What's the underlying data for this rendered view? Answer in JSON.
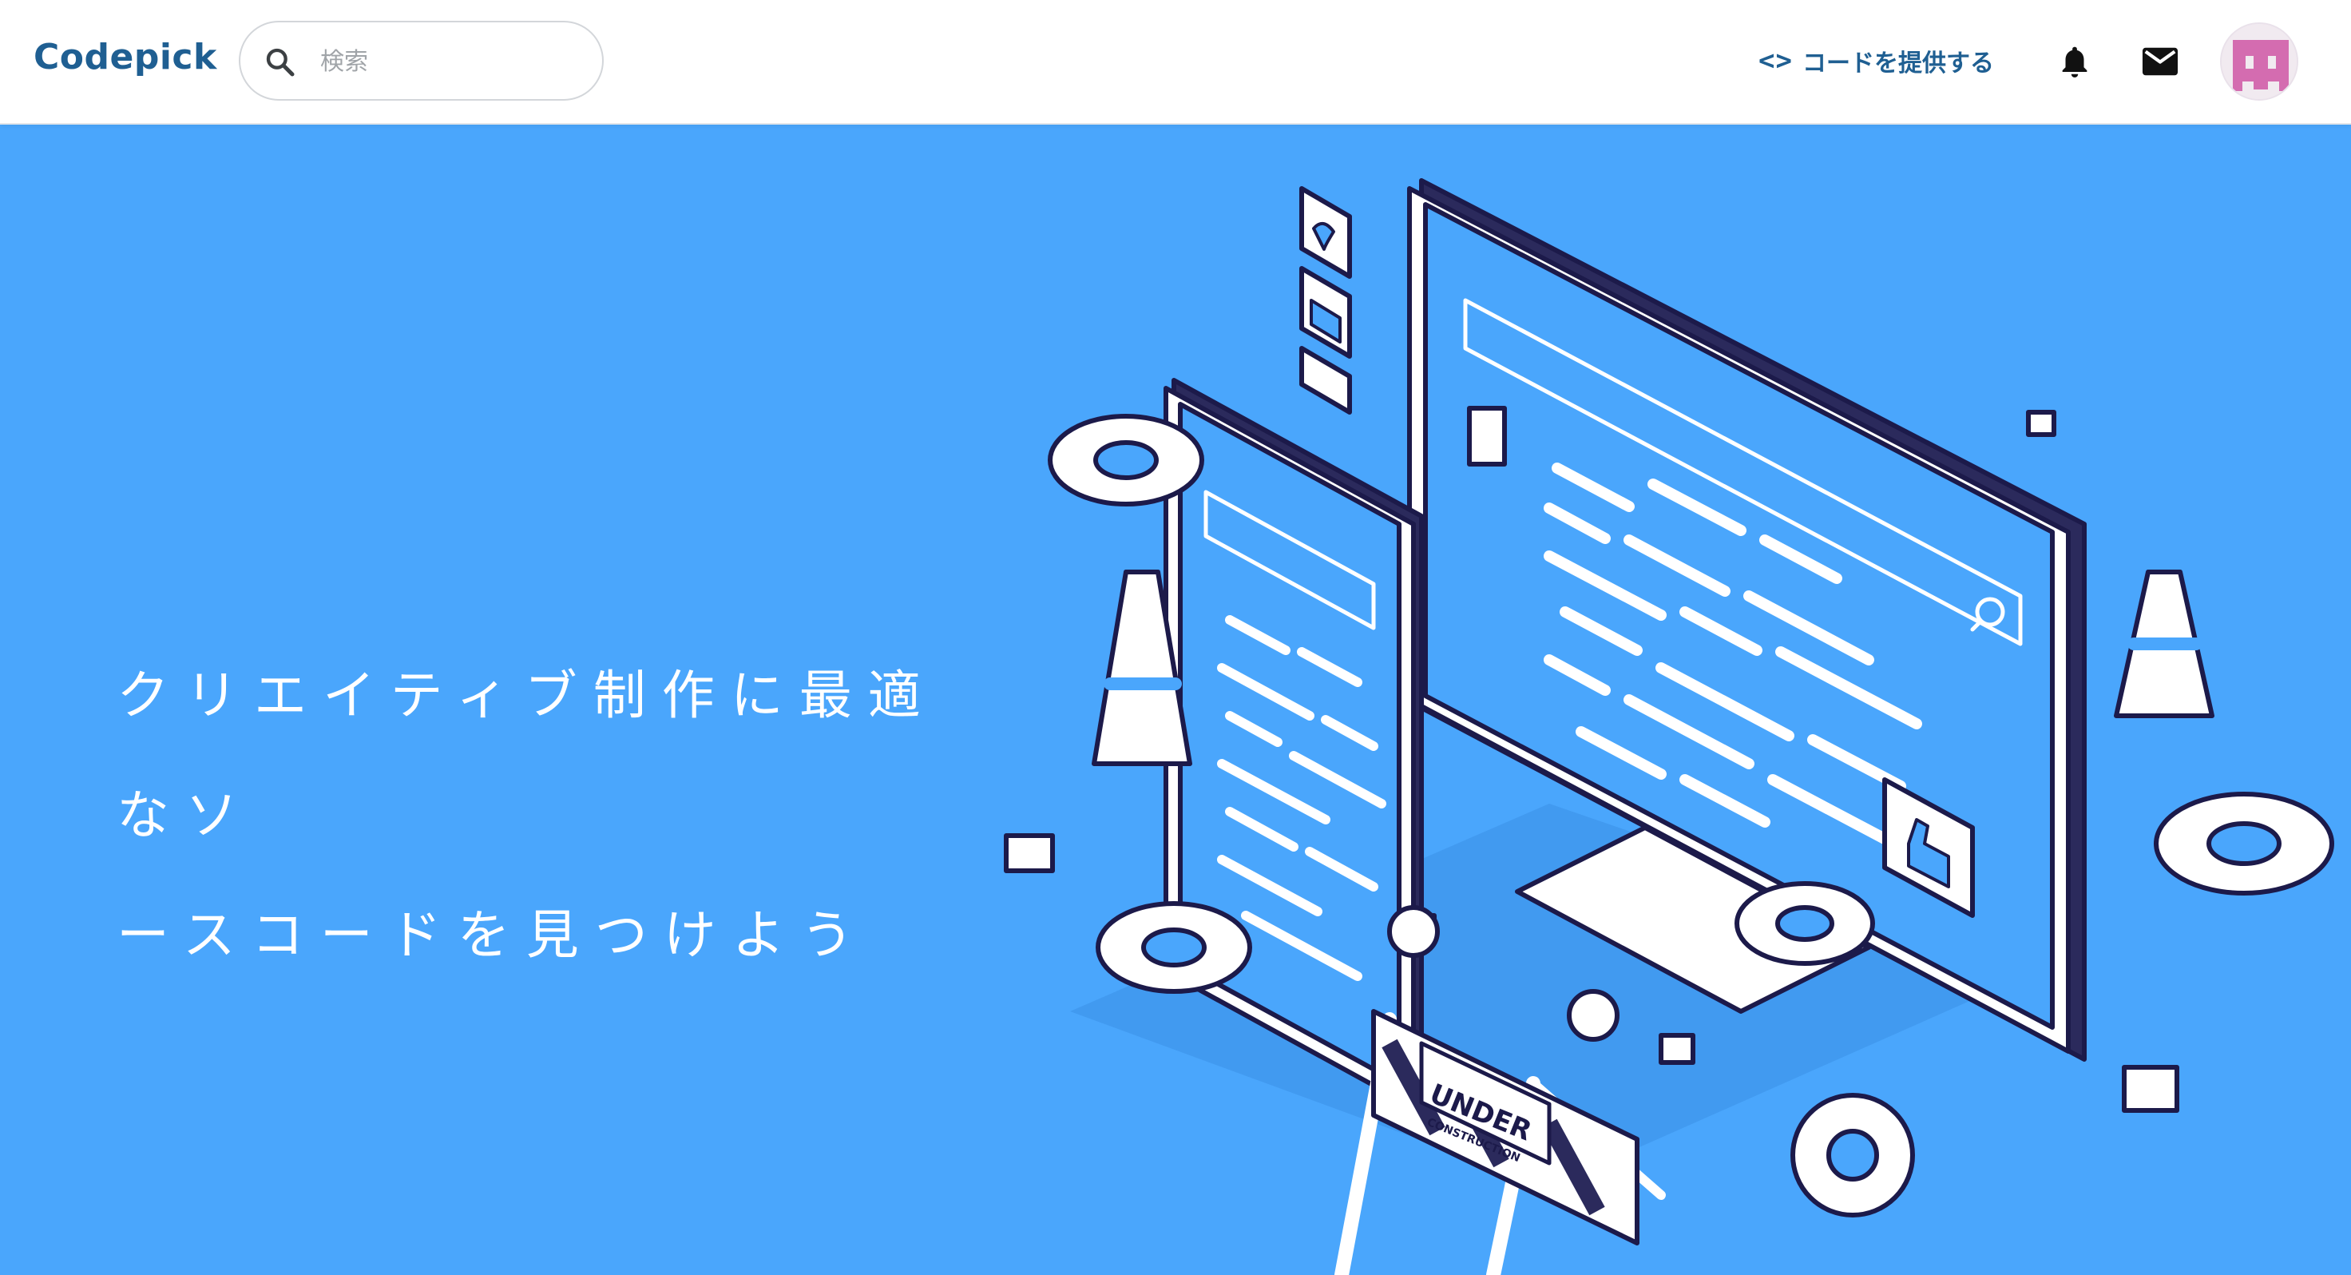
{
  "header": {
    "logo": "Codepick",
    "search": {
      "placeholder": "検索",
      "value": "",
      "icon": "search-icon"
    },
    "provide_code": {
      "icon_text": "<>",
      "label": "コードを提供する"
    },
    "notifications_icon": "bell-icon",
    "messages_icon": "mail-icon",
    "avatar": {
      "colors": [
        "#d46cb0",
        "#f1eaf0"
      ]
    }
  },
  "hero": {
    "headline_line1": "クリエイティブ制作に最適なソ",
    "headline_line2": "ースコードを見つけよう",
    "background": "#4aa6fc",
    "illustration_sign": {
      "line1": "UNDER",
      "line2": "CONSTRUCTION"
    }
  }
}
